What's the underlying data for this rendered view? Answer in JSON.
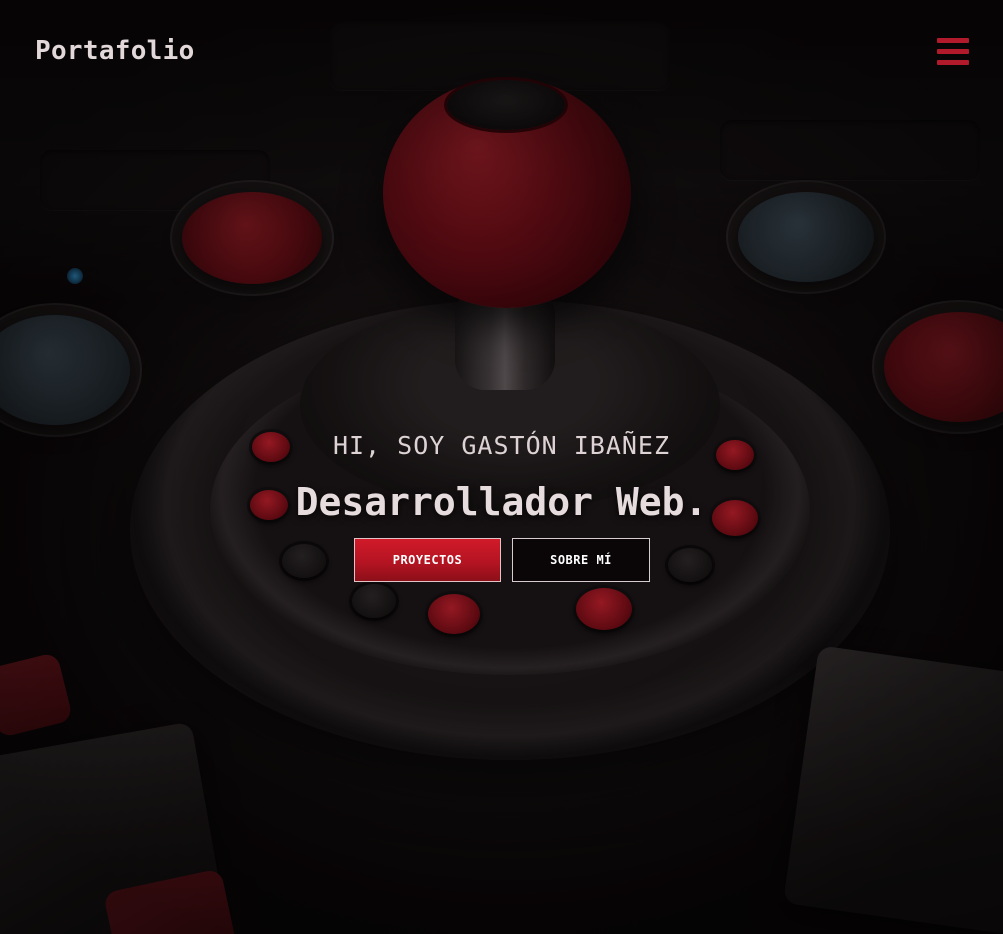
{
  "navbar": {
    "brand": "Portafolio",
    "menu_icon": "hamburger-menu-icon"
  },
  "hero": {
    "greeting": "HI, SOY GASTÓN IBAÑEZ",
    "headline": "Desarrollador Web.",
    "buttons": {
      "primary_label": "PROYECTOS",
      "secondary_label": "SOBRE MÍ"
    },
    "background_image": "arcade-joystick-red-knob"
  },
  "colors": {
    "accent": "#b01a2a",
    "primary_button": "#c3172a",
    "text_light": "#e2d8d9",
    "background": "#0b0709"
  }
}
